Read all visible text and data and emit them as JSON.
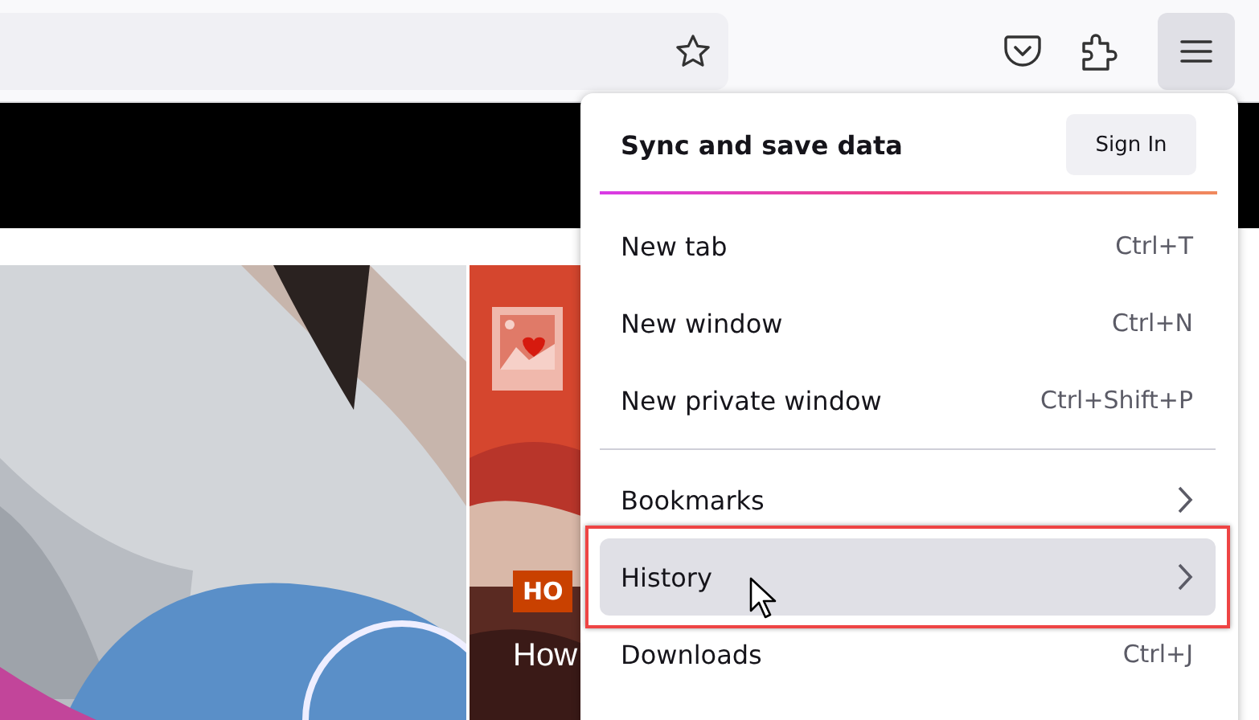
{
  "toolbar": {
    "menu_button": {
      "selected": true
    }
  },
  "articles": [
    {
      "kind": "picture"
    },
    {
      "kind": "picture",
      "tag": "HO",
      "title": "How"
    }
  ],
  "menu": {
    "header": {
      "title": "Sync and save data",
      "button": "Sign In"
    },
    "sections": [
      {
        "items": [
          {
            "kind": "shortcut",
            "label": "New tab",
            "shortcut": "Ctrl+T",
            "highlighted": false
          },
          {
            "kind": "shortcut",
            "label": "New window",
            "shortcut": "Ctrl+N",
            "highlighted": false
          },
          {
            "kind": "shortcut",
            "label": "New private window",
            "shortcut": "Ctrl+Shift+P",
            "highlighted": false
          }
        ]
      },
      {
        "items": [
          {
            "kind": "submenu",
            "label": "Bookmarks",
            "highlighted": false
          },
          {
            "kind": "submenu",
            "label": "History",
            "highlighted": true
          },
          {
            "kind": "shortcut",
            "label": "Downloads",
            "shortcut": "Ctrl+J",
            "highlighted": false
          }
        ]
      }
    ]
  }
}
